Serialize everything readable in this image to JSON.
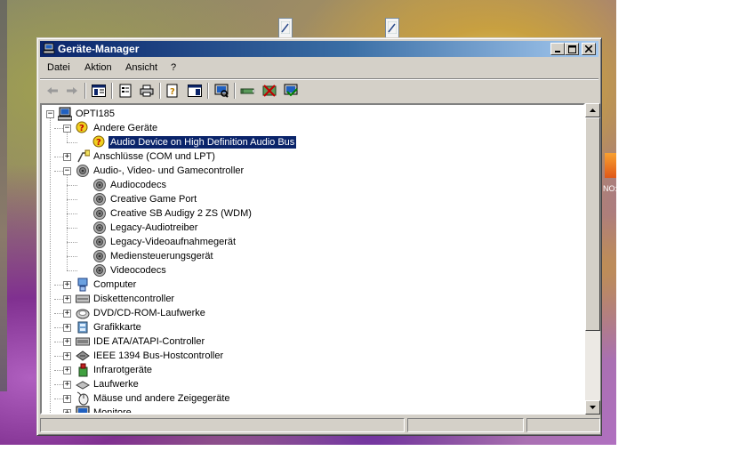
{
  "window": {
    "title": "Geräte-Manager",
    "controls": [
      "minimize",
      "maximize",
      "close"
    ]
  },
  "menu": {
    "items": [
      "Datei",
      "Aktion",
      "Ansicht",
      "?"
    ]
  },
  "toolbar": {
    "icons": [
      "back-arrow-icon",
      "forward-arrow-icon",
      "show-hide-tree-icon",
      "properties-icon",
      "print-icon",
      "help-icon",
      "show-hide-pane-icon",
      "scan-hardware-icon",
      "update-driver-icon",
      "uninstall-icon",
      "disable-device-icon"
    ]
  },
  "tree": {
    "root": "OPTI185",
    "items": [
      {
        "label": "OPTI185",
        "level": 0,
        "expander": "minus",
        "icon": "computer-icon"
      },
      {
        "label": "Andere Geräte",
        "level": 1,
        "expander": "minus",
        "icon": "unknown-device-icon"
      },
      {
        "label": "Audio Device on High Definition Audio Bus",
        "level": 2,
        "expander": "none",
        "icon": "unknown-device-icon",
        "selected": true
      },
      {
        "label": "Anschlüsse (COM und LPT)",
        "level": 1,
        "expander": "plus",
        "icon": "port-icon"
      },
      {
        "label": "Audio-, Video- und Gamecontroller",
        "level": 1,
        "expander": "minus",
        "icon": "speaker-icon"
      },
      {
        "label": "Audiocodecs",
        "level": 2,
        "expander": "none",
        "icon": "speaker-icon"
      },
      {
        "label": "Creative Game Port",
        "level": 2,
        "expander": "none",
        "icon": "speaker-icon"
      },
      {
        "label": "Creative SB Audigy 2 ZS (WDM)",
        "level": 2,
        "expander": "none",
        "icon": "speaker-icon"
      },
      {
        "label": "Legacy-Audiotreiber",
        "level": 2,
        "expander": "none",
        "icon": "speaker-icon"
      },
      {
        "label": "Legacy-Videoaufnahmegerät",
        "level": 2,
        "expander": "none",
        "icon": "speaker-icon"
      },
      {
        "label": "Mediensteuerungsgerät",
        "level": 2,
        "expander": "none",
        "icon": "speaker-icon"
      },
      {
        "label": "Videocodecs",
        "level": 2,
        "expander": "none",
        "icon": "speaker-icon"
      },
      {
        "label": "Computer",
        "level": 1,
        "expander": "plus",
        "icon": "computer-category-icon"
      },
      {
        "label": "Diskettencontroller",
        "level": 1,
        "expander": "plus",
        "icon": "floppy-controller-icon"
      },
      {
        "label": "DVD/CD-ROM-Laufwerke",
        "level": 1,
        "expander": "plus",
        "icon": "cdrom-icon"
      },
      {
        "label": "Grafikkarte",
        "level": 1,
        "expander": "plus",
        "icon": "display-adapter-icon"
      },
      {
        "label": "IDE ATA/ATAPI-Controller",
        "level": 1,
        "expander": "plus",
        "icon": "ide-controller-icon"
      },
      {
        "label": "IEEE 1394 Bus-Hostcontroller",
        "level": 1,
        "expander": "plus",
        "icon": "firewire-icon"
      },
      {
        "label": "Infrarotgeräte",
        "level": 1,
        "expander": "plus",
        "icon": "infrared-icon"
      },
      {
        "label": "Laufwerke",
        "level": 1,
        "expander": "plus",
        "icon": "disk-drive-icon"
      },
      {
        "label": "Mäuse und andere Zeigegeräte",
        "level": 1,
        "expander": "plus",
        "icon": "mouse-icon"
      },
      {
        "label": "Monitore",
        "level": 1,
        "expander": "plus",
        "icon": "monitor-icon"
      }
    ]
  },
  "desktop": {
    "partial_label": "NO:"
  },
  "colors": {
    "titlebar_start": "#0a246a",
    "titlebar_end": "#a6caf0",
    "selection": "#0a246a",
    "face": "#d4d0c8"
  }
}
